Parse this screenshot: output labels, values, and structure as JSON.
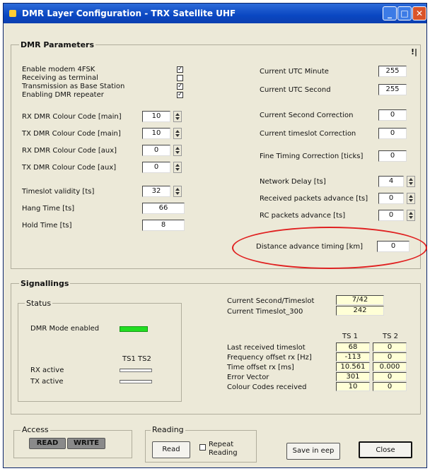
{
  "window": {
    "title": "DMR Layer Configuration - TRX Satellite UHF"
  },
  "dmr": {
    "title": "DMR Parameters",
    "pin_glyph": "!|",
    "checks": [
      {
        "label": "Enable modem 4FSK",
        "checked": true
      },
      {
        "label": "Receiving as terminal",
        "checked": false
      },
      {
        "label": "Transmission as Base Station",
        "checked": true
      },
      {
        "label": "Enabling DMR repeater",
        "checked": true
      }
    ],
    "left_fields": [
      {
        "label": "RX DMR Colour Code [main]",
        "value": "10"
      },
      {
        "label": "TX DMR Colour Code [main]",
        "value": "10"
      },
      {
        "label": "RX DMR Colour Code [aux]",
        "value": "0"
      },
      {
        "label": "TX DMR Colour Code [aux]",
        "value": "0"
      },
      {
        "label": "Timeslot validity [ts]",
        "value": "32"
      },
      {
        "label": "Hang Time [ts]",
        "value": "66"
      },
      {
        "label": "Hold Time [ts]",
        "value": "8"
      }
    ],
    "right_fields": [
      {
        "label": "Current UTC Minute",
        "value": "255"
      },
      {
        "label": "Current UTC Second",
        "value": "255"
      },
      {
        "label": "Current Second Correction",
        "value": "0"
      },
      {
        "label": "Current timeslot Correction",
        "value": "0"
      },
      {
        "label": "Fine Timing Correction [ticks]",
        "value": "0"
      },
      {
        "label": "Network Delay [ts]",
        "value": "4"
      },
      {
        "label": "Received packets advance [ts]",
        "value": "0"
      },
      {
        "label": "RC packets advance [ts]",
        "value": "0"
      },
      {
        "label": "Distance advance timing [km]",
        "value": "0"
      }
    ]
  },
  "sig": {
    "title": "Signallings",
    "status_title": "Status",
    "dmr_mode_label": "DMR Mode enabled",
    "ts1_label": "TS1",
    "ts2_label": "TS2",
    "rx_label": "RX active",
    "tx_label": "TX active",
    "current_second_label": "Current Second/Timeslot",
    "current_second_value": "7/42",
    "timeslot300_label": "Current Timeslot_300",
    "timeslot300_value": "242",
    "col_ts1": "TS 1",
    "col_ts2": "TS 2",
    "rows": [
      {
        "label": "Last received timeslot",
        "ts1": "68",
        "ts2": "0"
      },
      {
        "label": "Frequency offset rx [Hz]",
        "ts1": "-113",
        "ts2": "0"
      },
      {
        "label": "Time offset rx [ms]",
        "ts1": "10.561",
        "ts2": "0.000"
      },
      {
        "label": "Error Vector",
        "ts1": "301",
        "ts2": "0"
      },
      {
        "label": "Colour Codes received",
        "ts1": "10",
        "ts2": "0"
      }
    ]
  },
  "access": {
    "title": "Access",
    "read": "READ",
    "write": "WRITE"
  },
  "reading": {
    "title": "Reading",
    "read_button": "Read",
    "repeat_label_1": "Repeat",
    "repeat_label_2": "Reading"
  },
  "buttons": {
    "save": "Save in eep",
    "close": "Close"
  },
  "colors": {
    "titlebar": "#0a47c2",
    "led_active": "#22dd22",
    "highlight_ellipse": "#e02020"
  }
}
